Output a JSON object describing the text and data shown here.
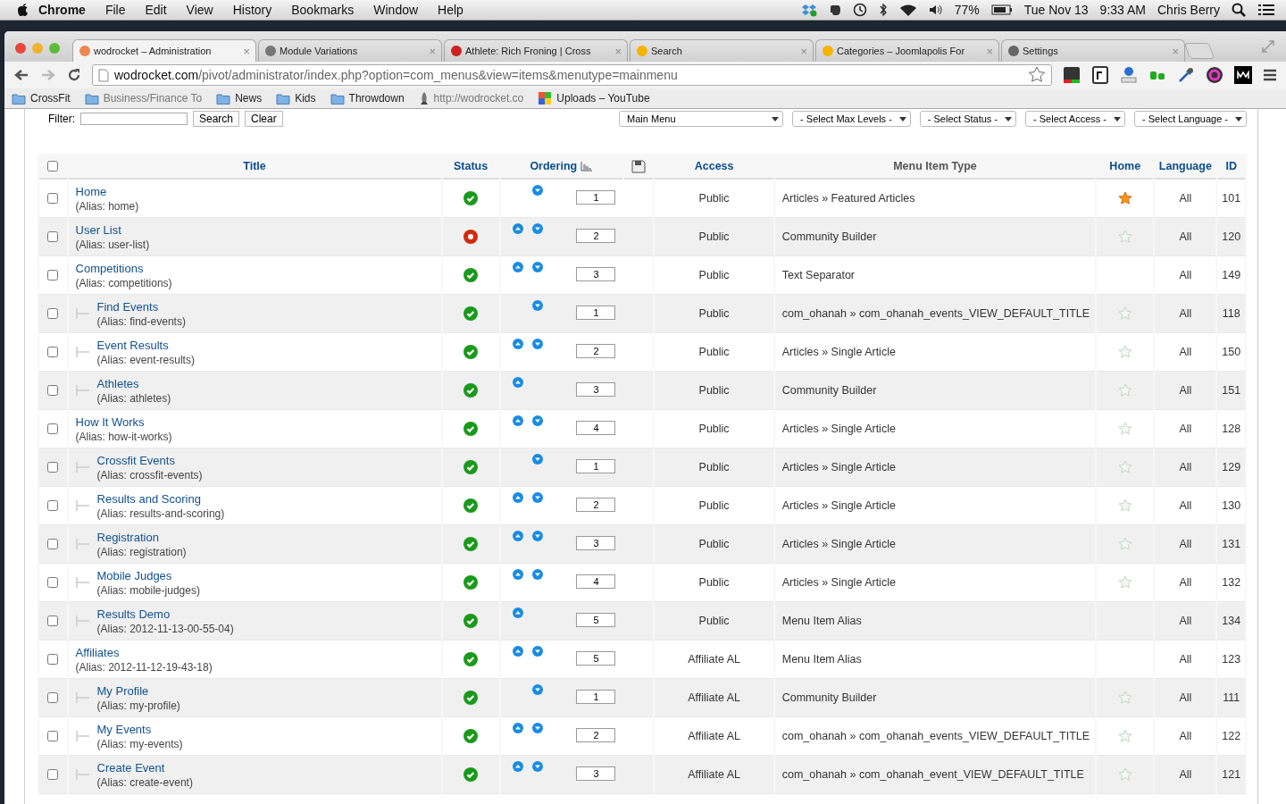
{
  "menubar": {
    "app": "Chrome",
    "items": [
      "File",
      "Edit",
      "View",
      "History",
      "Bookmarks",
      "Window",
      "Help"
    ],
    "battery": "77%",
    "date": "Tue Nov 13",
    "time": "9:33 AM",
    "user": "Chris Berry"
  },
  "tabs": [
    {
      "title": "wodrocket – Administration",
      "close": "×",
      "selected": true
    },
    {
      "title": "Module Variations",
      "close": "×",
      "selected": false
    },
    {
      "title": "Athlete: Rich Froning | Cross",
      "close": "×",
      "selected": false
    },
    {
      "title": "Search",
      "close": "×",
      "selected": false
    },
    {
      "title": "Categories – Joomlapolis For",
      "close": "×",
      "selected": false
    },
    {
      "title": "Settings",
      "close": "×",
      "selected": false
    }
  ],
  "address": {
    "host": "wodrocket.com",
    "path": "/pivot/administrator/index.php?option=com_menus&view=items&menutype=mainmenu"
  },
  "bookmarks": [
    "CrossFit",
    "Business/Finance To",
    "News",
    "Kids",
    "Throwdown",
    "http://wodrocket.co",
    "Uploads – YouTube"
  ],
  "filter": {
    "label": "Filter:",
    "buttons": [
      "Search",
      "Clear"
    ],
    "selects": [
      "Main Menu",
      "- Select Max Levels -",
      "- Select Status -",
      "- Select Access -",
      "- Select Language -"
    ]
  },
  "table": {
    "select_all": {
      "checked": false
    },
    "columns": [
      {
        "label": "Title",
        "link": true
      },
      {
        "label": "Status",
        "link": true
      },
      {
        "label": "Ordering",
        "link": true
      },
      {
        "label": "Access",
        "link": true
      },
      {
        "label": "Menu Item Type",
        "link": false
      },
      {
        "label": "Home",
        "link": true
      },
      {
        "label": "Language",
        "link": true
      },
      {
        "label": "ID",
        "link": true
      }
    ],
    "rows": [
      {
        "title": "Home",
        "alias": "(Alias: home)",
        "selected": false,
        "published": true,
        "up": false,
        "down": true,
        "order": "1",
        "access": "Public",
        "type": "Articles » Featured Articles",
        "star": true,
        "is_home": true,
        "language": "All",
        "id": "101"
      },
      {
        "title": "User List",
        "alias": "(Alias: user-list)",
        "selected": false,
        "published": false,
        "up": true,
        "down": true,
        "order": "2",
        "access": "Public",
        "type": "Community Builder",
        "star": true,
        "is_home": false,
        "language": "All",
        "id": "120"
      },
      {
        "title": "Competitions",
        "alias": "(Alias: competitions)",
        "selected": false,
        "published": true,
        "up": true,
        "down": true,
        "order": "3",
        "access": "Public",
        "type": "Text Separator",
        "star": false,
        "language": "All",
        "id": "149",
        "children": [
          {
            "title": "Find Events",
            "alias": "(Alias: find-events)",
            "selected": false,
            "published": true,
            "up": false,
            "down": true,
            "order": "1",
            "access": "Public",
            "type": "com_ohanah » com_ohanah_events_VIEW_DEFAULT_TITLE",
            "star": true,
            "is_home": false,
            "language": "All",
            "id": "118"
          },
          {
            "title": "Event Results",
            "alias": "(Alias: event-results)",
            "selected": false,
            "published": true,
            "up": true,
            "down": true,
            "order": "2",
            "access": "Public",
            "type": "Articles » Single Article",
            "star": true,
            "is_home": false,
            "language": "All",
            "id": "150"
          },
          {
            "title": "Athletes",
            "alias": "(Alias: athletes)",
            "selected": false,
            "published": true,
            "up": true,
            "down": false,
            "order": "3",
            "access": "Public",
            "type": "Community Builder",
            "star": true,
            "is_home": false,
            "language": "All",
            "id": "151"
          }
        ]
      },
      {
        "title": "How It Works",
        "alias": "(Alias: how-it-works)",
        "selected": false,
        "published": true,
        "up": true,
        "down": true,
        "order": "4",
        "access": "Public",
        "type": "Articles » Single Article",
        "star": true,
        "is_home": false,
        "language": "All",
        "id": "128",
        "children": [
          {
            "title": "Crossfit Events",
            "alias": "(Alias: crossfit-events)",
            "selected": false,
            "published": true,
            "up": false,
            "down": true,
            "order": "1",
            "access": "Public",
            "type": "Articles » Single Article",
            "star": true,
            "is_home": false,
            "language": "All",
            "id": "129"
          },
          {
            "title": "Results and Scoring",
            "alias": "(Alias: results-and-scoring)",
            "selected": false,
            "published": true,
            "up": true,
            "down": true,
            "order": "2",
            "access": "Public",
            "type": "Articles » Single Article",
            "star": true,
            "is_home": false,
            "language": "All",
            "id": "130"
          },
          {
            "title": "Registration",
            "alias": "(Alias: registration)",
            "selected": false,
            "published": true,
            "up": true,
            "down": true,
            "order": "3",
            "access": "Public",
            "type": "Articles » Single Article",
            "star": true,
            "is_home": false,
            "language": "All",
            "id": "131"
          },
          {
            "title": "Mobile Judges",
            "alias": "(Alias: mobile-judges)",
            "selected": false,
            "published": true,
            "up": true,
            "down": true,
            "order": "4",
            "access": "Public",
            "type": "Articles » Single Article",
            "star": true,
            "is_home": false,
            "language": "All",
            "id": "132"
          },
          {
            "title": "Results Demo",
            "alias": "(Alias: 2012-11-13-00-55-04)",
            "selected": false,
            "published": true,
            "up": true,
            "down": false,
            "order": "5",
            "access": "Public",
            "type": "Menu Item Alias",
            "star": false,
            "language": "All",
            "id": "134"
          }
        ]
      },
      {
        "title": "Affiliates",
        "alias": "(Alias: 2012-11-12-19-43-18)",
        "selected": false,
        "published": true,
        "up": true,
        "down": true,
        "order": "5",
        "access": "Affiliate AL",
        "type": "Menu Item Alias",
        "star": false,
        "language": "All",
        "id": "123",
        "children": [
          {
            "title": "My Profile",
            "alias": "(Alias: my-profile)",
            "selected": false,
            "published": true,
            "up": false,
            "down": true,
            "order": "1",
            "access": "Affiliate AL",
            "type": "Community Builder",
            "star": true,
            "is_home": false,
            "language": "All",
            "id": "111"
          },
          {
            "title": "My Events",
            "alias": "(Alias: my-events)",
            "selected": false,
            "published": true,
            "up": true,
            "down": true,
            "order": "2",
            "access": "Affiliate AL",
            "type": "com_ohanah » com_ohanah_events_VIEW_DEFAULT_TITLE",
            "star": true,
            "is_home": false,
            "language": "All",
            "id": "122"
          },
          {
            "title": "Create Event",
            "alias": "(Alias: create-event)",
            "selected": false,
            "published": true,
            "up": true,
            "down": true,
            "order": "3",
            "access": "Affiliate AL",
            "type": "com_ohanah » com_ohanah_event_VIEW_DEFAULT_TITLE",
            "star": true,
            "is_home": false,
            "language": "All",
            "id": "121"
          }
        ]
      }
    ]
  }
}
